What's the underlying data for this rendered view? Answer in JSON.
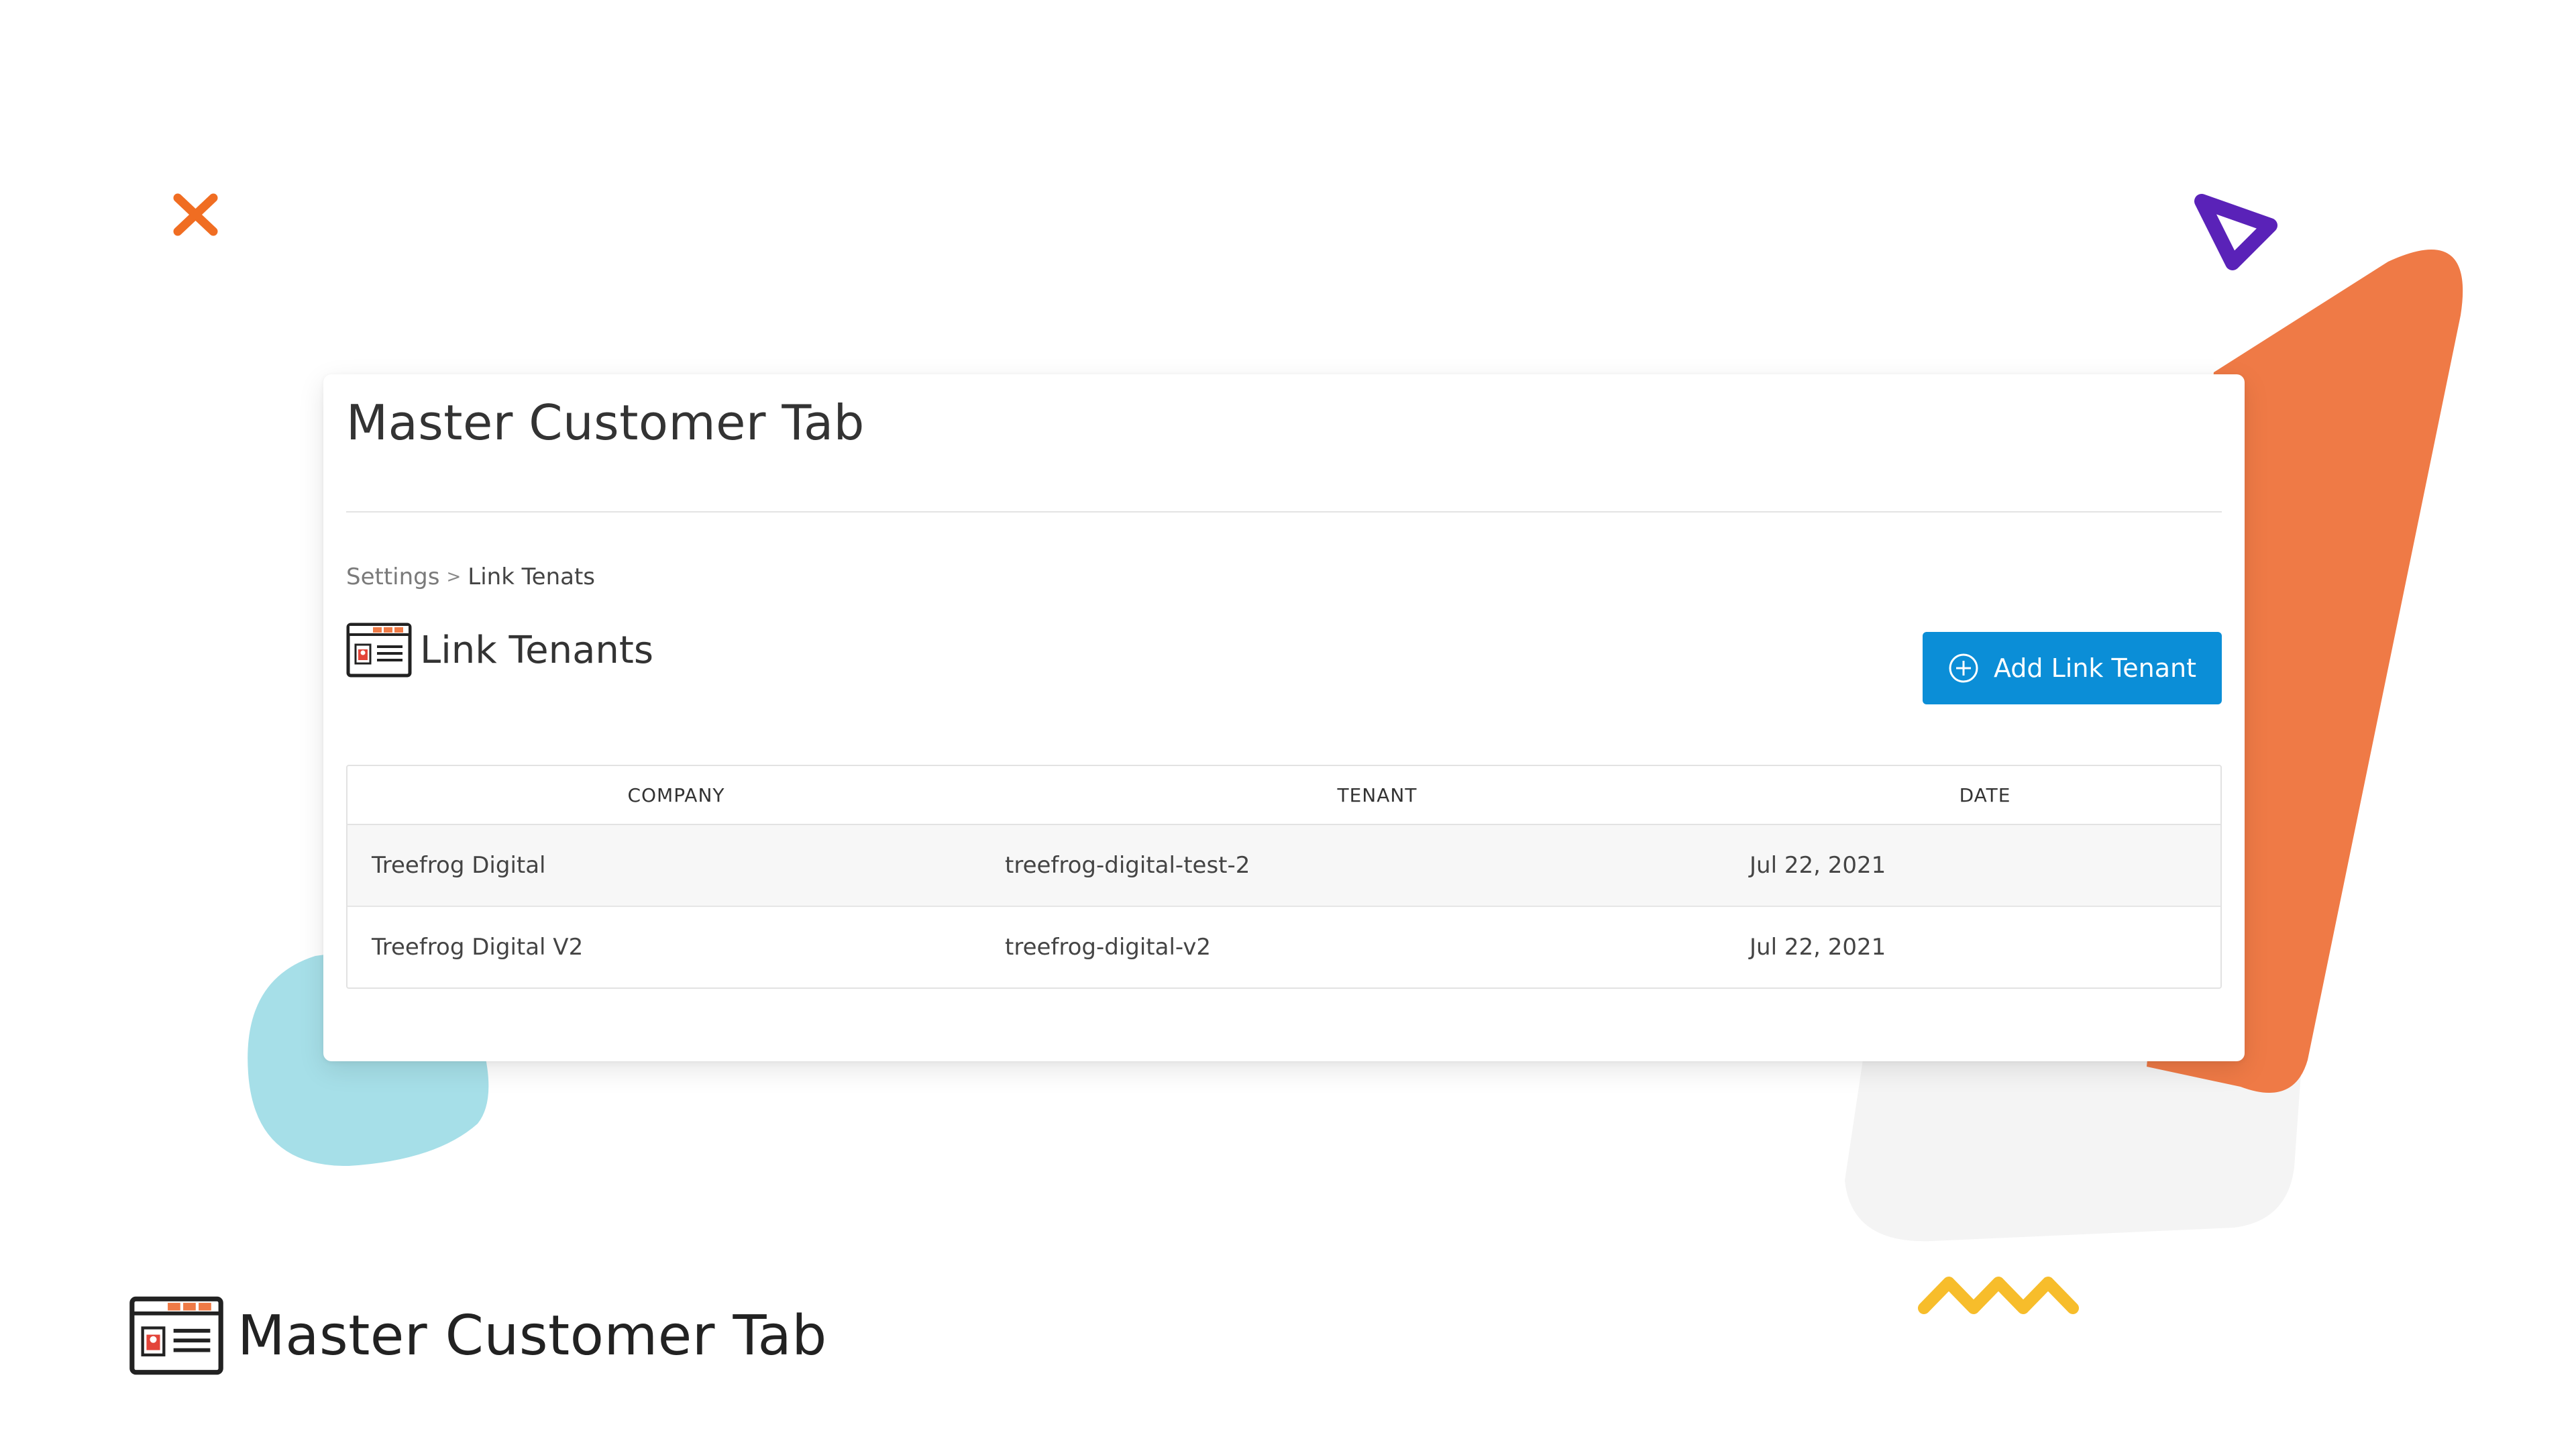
{
  "card": {
    "title": "Master Customer Tab",
    "breadcrumb": {
      "parent": "Settings",
      "separator": ">",
      "current": "Link Tenats"
    },
    "section_title": "Link Tenants",
    "add_button_label": "Add Link Tenant",
    "table": {
      "headers": {
        "company": "COMPANY",
        "tenant": "TENANT",
        "date": "DATE"
      },
      "rows": [
        {
          "company": "Treefrog Digital",
          "tenant": "treefrog-digital-test-2",
          "date": "Jul 22, 2021"
        },
        {
          "company": "Treefrog Digital V2",
          "tenant": "treefrog-digital-v2",
          "date": "Jul 22, 2021"
        }
      ]
    }
  },
  "brand": {
    "title": "Master Customer Tab"
  },
  "colors": {
    "accent_button": "#0b8ed7",
    "deco_orange": "#ef7a46",
    "deco_purple": "#5a22b8",
    "deco_cyan": "#a6dfe8",
    "deco_yellow": "#f7bd2b",
    "deco_cross": "#f06d22"
  },
  "icons": {
    "section": "customer-card-icon",
    "button": "plus-circle-icon",
    "brand": "customer-card-icon"
  }
}
